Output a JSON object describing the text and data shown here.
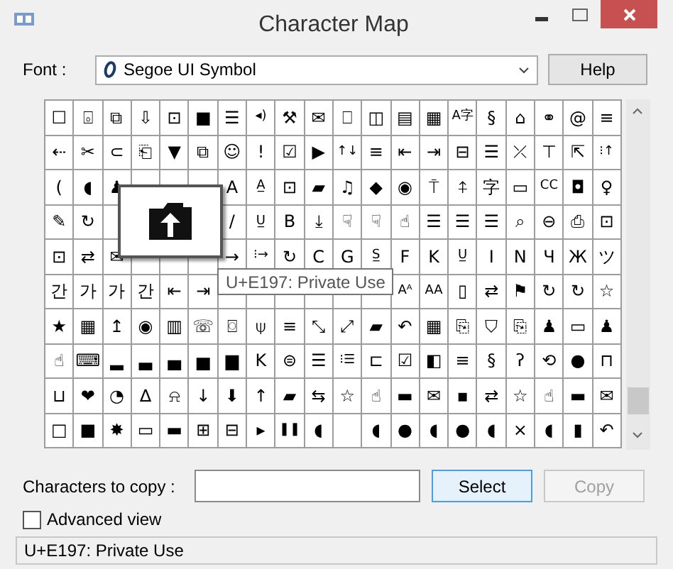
{
  "window": {
    "title": "Character Map"
  },
  "font": {
    "label": "Font :",
    "value": "Segoe UI Symbol"
  },
  "help_button": {
    "label": "Help"
  },
  "grid": {
    "rows": [
      [
        "☐",
        "⌻",
        "⧉",
        "⇩",
        "⊡",
        "■",
        "☰",
        "◂)",
        "⚒",
        "✉",
        "⎕",
        "◫",
        "▤",
        "▦",
        "A字",
        "§",
        "⌂",
        "⚭",
        "@",
        "≡"
      ],
      [
        "⇠",
        "✂",
        "⊂",
        "⎗",
        "▼",
        "⧉",
        "☺",
        "!",
        "☑",
        "▶",
        "↑↓",
        "≡",
        "⇤",
        "⇥",
        "⊟",
        "☰",
        "⤫",
        "⊤",
        "⇱",
        "⁝↑"
      ],
      [
        "(",
        "◖",
        "♟",
        null,
        null,
        null,
        "A",
        "A̲",
        "⊡",
        "▰",
        "♫",
        "◆",
        "◉",
        "⍑",
        "⍏",
        "字",
        "▭",
        "CC",
        "◘",
        "♀"
      ],
      [
        "✎",
        "↻",
        null,
        null,
        null,
        null,
        "/",
        "U̲",
        "B",
        "⤓",
        "☟",
        "☟",
        "☝",
        "☰",
        "☰",
        "☰",
        "⌕",
        "⊖",
        "⎙",
        "⊡"
      ],
      [
        "⊡",
        "⇄",
        "✉",
        null,
        null,
        null,
        "→",
        "⁝→",
        "↻",
        "C",
        "G",
        "S̲",
        "F",
        "K",
        "U̲",
        "I",
        "N",
        "Ч",
        "Ж",
        "ツ"
      ],
      [
        "간",
        "가",
        "가",
        "간",
        "⇤",
        "⇥",
        null,
        null,
        null,
        null,
        null,
        null,
        "Aᴬ",
        "AA",
        "▯",
        "⇄",
        "⚑",
        "↻",
        "↻",
        "☆"
      ],
      [
        "★",
        "▦",
        "↥",
        "◉",
        "▥",
        "☏",
        "⌼",
        "⍦",
        "≡",
        "⤡",
        "⤢",
        "▰",
        "↶",
        "▦",
        "⎘",
        "⛉",
        "⎘",
        "♟",
        "▭",
        "♟"
      ],
      [
        "☝",
        "⌨",
        "▂",
        "▃",
        "▄",
        "▅",
        "▆",
        "K",
        "⊜",
        "☰",
        "⁝☰",
        "⊏",
        "☑",
        "◧",
        "≡",
        "§",
        "ʔ",
        "⟲",
        "●",
        "⊓"
      ],
      [
        "⊔",
        "❤",
        "◔",
        "∆",
        "⍾",
        "↓",
        "⬇",
        "↑",
        "▰",
        "⇆",
        "☆",
        "☝",
        "▬",
        "✉",
        "▪",
        "⇄",
        "☆",
        "☝",
        "▬",
        "✉"
      ],
      [
        "□",
        "■",
        "✸",
        "▭",
        "▬",
        "⊞",
        "⊟",
        "▸",
        "❚❚",
        "◖",
        null,
        "◖",
        "●",
        "◖",
        "●",
        "◖",
        "×",
        "◖",
        "▮",
        "↶"
      ]
    ]
  },
  "magnifier": {
    "tooltip": "U+E197: Private Use"
  },
  "copy": {
    "label": "Characters to copy :"
  },
  "buttons": [
    {
      "label": "Select",
      "disabled": false,
      "focused": true
    },
    {
      "label": "Copy",
      "disabled": true,
      "focused": false
    }
  ],
  "advanced_view": {
    "label": "Advanced view",
    "checked": false
  },
  "status_bar": "U+E197: Private Use"
}
